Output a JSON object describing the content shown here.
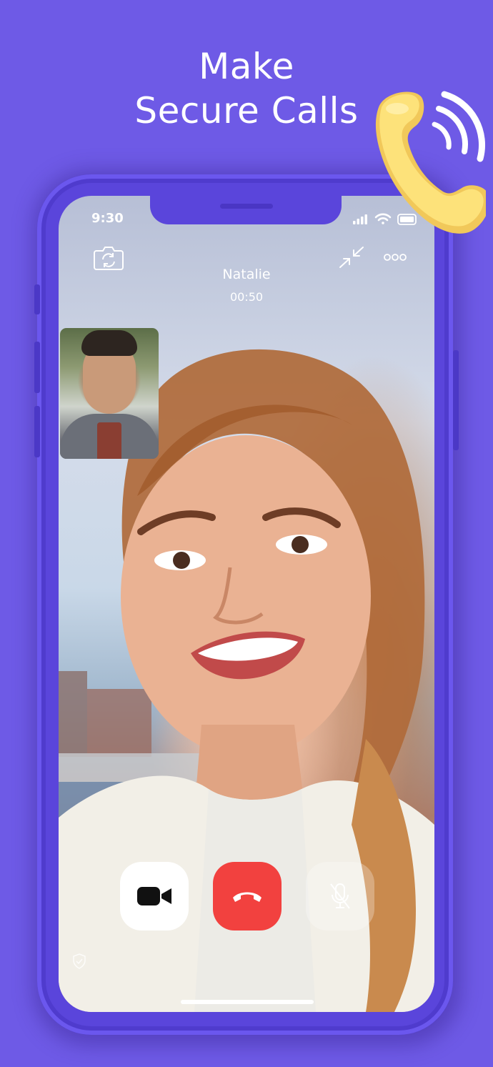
{
  "promo": {
    "headline_line1": "Make",
    "headline_line2": "Secure Calls"
  },
  "status_bar": {
    "time": "9:30",
    "icons": [
      "signal-icon",
      "wifi-icon",
      "battery-icon"
    ]
  },
  "call": {
    "caller_name": "Natalie",
    "duration": "00:50"
  },
  "top_controls": [
    "switch-camera-icon",
    "minimize-icon",
    "more-options-icon"
  ],
  "call_controls": [
    {
      "name": "video-toggle",
      "icon": "video-camera-icon"
    },
    {
      "name": "end-call",
      "icon": "hang-up-icon"
    },
    {
      "name": "mute",
      "icon": "microphone-muted-icon"
    }
  ],
  "colors": {
    "background": "#6e5ae6",
    "phone_frame": "#5a45db",
    "end_call": "#f2413f",
    "handset": "#fde27a"
  }
}
